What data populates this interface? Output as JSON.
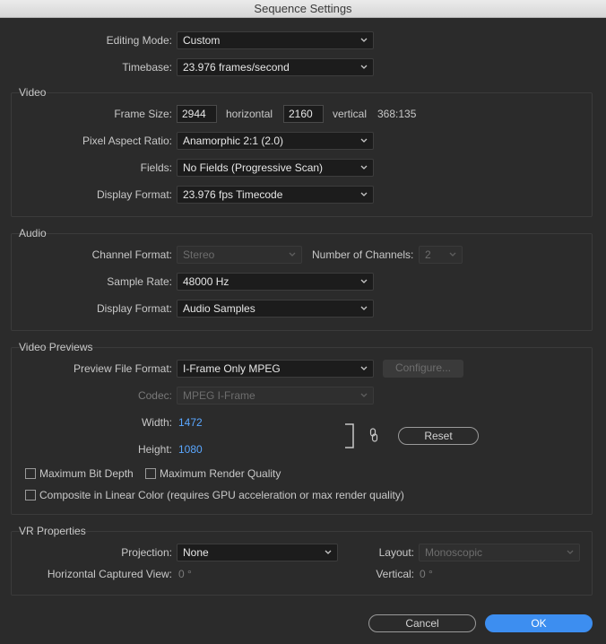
{
  "window": {
    "title": "Sequence Settings"
  },
  "general": {
    "editing_mode": {
      "label": "Editing Mode:",
      "value": "Custom"
    },
    "timebase": {
      "label": "Timebase:",
      "value": "23.976  frames/second"
    }
  },
  "video": {
    "title": "Video",
    "frame_size": {
      "label": "Frame Size:",
      "horizontal_value": "2944",
      "horizontal_label": "horizontal",
      "vertical_value": "2160",
      "vertical_label": "vertical",
      "ratio": "368:135"
    },
    "pixel_aspect": {
      "label": "Pixel Aspect Ratio:",
      "value": "Anamorphic 2:1 (2.0)"
    },
    "fields": {
      "label": "Fields:",
      "value": "No Fields (Progressive Scan)"
    },
    "display_format": {
      "label": "Display Format:",
      "value": "23.976 fps Timecode"
    }
  },
  "audio": {
    "title": "Audio",
    "channel_format": {
      "label": "Channel Format:",
      "value": "Stereo"
    },
    "num_channels": {
      "label": "Number of Channels:",
      "value": "2"
    },
    "sample_rate": {
      "label": "Sample Rate:",
      "value": "48000 Hz"
    },
    "display_format": {
      "label": "Display Format:",
      "value": "Audio Samples"
    }
  },
  "previews": {
    "title": "Video Previews",
    "preview_format": {
      "label": "Preview File Format:",
      "value": "I-Frame Only MPEG"
    },
    "configure_label": "Configure...",
    "codec": {
      "label": "Codec:",
      "value": "MPEG I-Frame"
    },
    "width": {
      "label": "Width:",
      "value": "1472"
    },
    "height": {
      "label": "Height:",
      "value": "1080"
    },
    "reset_label": "Reset",
    "max_bit_depth": "Maximum Bit Depth",
    "max_render_quality": "Maximum Render Quality",
    "composite_linear": "Composite in Linear Color (requires GPU acceleration or max render quality)"
  },
  "vr": {
    "title": "VR Properties",
    "projection": {
      "label": "Projection:",
      "value": "None"
    },
    "layout": {
      "label": "Layout:",
      "value": "Monoscopic"
    },
    "h_view": {
      "label": "Horizontal Captured View:",
      "value": "0 °"
    },
    "vertical": {
      "label": "Vertical:",
      "value": "0 °"
    }
  },
  "footer": {
    "cancel_label": "Cancel",
    "ok_label": "OK"
  },
  "colors": {
    "accent": "#3d8ef0",
    "link_value": "#5aa7ff",
    "background": "#2b2b2b"
  }
}
